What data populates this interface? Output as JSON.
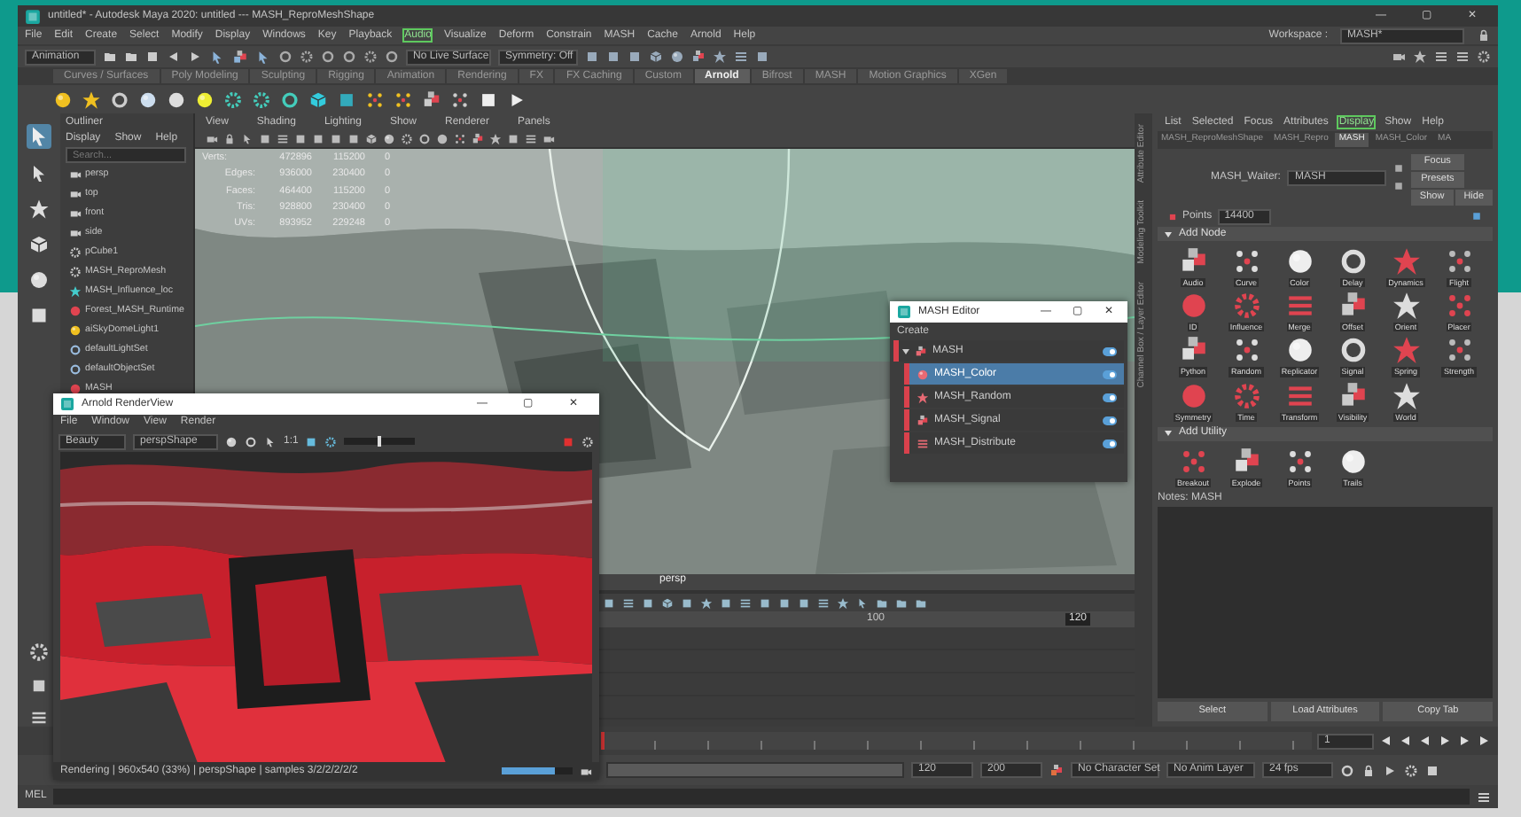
{
  "window": {
    "title": "untitled* - Autodesk Maya 2020: untitled   ---   MASH_ReproMeshShape",
    "controls": [
      "—",
      "▢",
      "✕"
    ],
    "workspace_label": "Workspace :",
    "workspace": "MASH*"
  },
  "menu": [
    {
      "label": "File",
      "selected": false
    },
    {
      "label": "Edit",
      "selected": false
    },
    {
      "label": "Create",
      "selected": false
    },
    {
      "label": "Select",
      "selected": false
    },
    {
      "label": "Modify",
      "selected": false
    },
    {
      "label": "Display",
      "selected": false
    },
    {
      "label": "Windows",
      "selected": false
    },
    {
      "label": "Key",
      "selected": false
    },
    {
      "label": "Playback",
      "selected": false
    },
    {
      "label": "Audio",
      "selected": true
    },
    {
      "label": "Visualize",
      "selected": false
    },
    {
      "label": "Deform",
      "selected": false
    },
    {
      "label": "Constrain",
      "selected": false
    },
    {
      "label": "MASH",
      "selected": false
    },
    {
      "label": "Cache",
      "selected": false
    },
    {
      "label": "Arnold",
      "selected": false
    },
    {
      "label": "Help",
      "selected": false
    }
  ],
  "status_line": {
    "mode": "Animation",
    "live_surface": "No Live Surface",
    "symmetry": "Symmetry: Off"
  },
  "shelf_tabs": [
    {
      "label": "Curves / Surfaces",
      "selected": false
    },
    {
      "label": "Poly Modeling",
      "selected": false
    },
    {
      "label": "Sculpting",
      "selected": false
    },
    {
      "label": "Rigging",
      "selected": false
    },
    {
      "label": "Animation",
      "selected": false
    },
    {
      "label": "Rendering",
      "selected": false
    },
    {
      "label": "FX",
      "selected": false
    },
    {
      "label": "FX Caching",
      "selected": false
    },
    {
      "label": "Custom",
      "selected": false
    },
    {
      "label": "Arnold",
      "selected": true
    },
    {
      "label": "Bifrost",
      "selected": false
    },
    {
      "label": "MASH",
      "selected": false
    },
    {
      "label": "Motion Graphics",
      "selected": false
    },
    {
      "label": "XGen",
      "selected": false
    }
  ],
  "outliner": {
    "title": "Outliner",
    "menu": [
      "Display",
      "Show",
      "Help"
    ],
    "placeholder": "Search...",
    "items": [
      {
        "label": "persp",
        "kind": "camera"
      },
      {
        "label": "top",
        "kind": "camera"
      },
      {
        "label": "front",
        "kind": "camera"
      },
      {
        "label": "side",
        "kind": "camera"
      },
      {
        "label": "pCube1",
        "kind": "mesh"
      },
      {
        "label": "MASH_ReproMesh",
        "kind": "mesh"
      },
      {
        "label": "MASH_Influence_loc",
        "kind": "locator"
      },
      {
        "label": "Forest_MASH_Runtime",
        "kind": "runtime"
      },
      {
        "label": "aiSkyDomeLight1",
        "kind": "light"
      },
      {
        "label": "defaultLightSet",
        "kind": "set"
      },
      {
        "label": "defaultObjectSet",
        "kind": "set"
      },
      {
        "label": "MASH",
        "kind": "mash"
      }
    ]
  },
  "viewport": {
    "menu": [
      "View",
      "Shading",
      "Lighting",
      "Show",
      "Renderer",
      "Panels"
    ],
    "hud": [
      {
        "label": "Verts:",
        "values": [
          "472896",
          "115200",
          "0"
        ]
      },
      {
        "label": "Edges:",
        "values": [
          "936000",
          "230400",
          "0"
        ]
      },
      {
        "label": "Faces:",
        "values": [
          "464400",
          "115200",
          "0"
        ]
      },
      {
        "label": "Tris:",
        "values": [
          "928800",
          "230400",
          "0"
        ]
      },
      {
        "label": "UVs:",
        "values": [
          "893952",
          "229248",
          "0"
        ]
      }
    ],
    "camera": "persp"
  },
  "time_editor": {
    "ruler": [
      {
        "label": "100",
        "kind": "tick"
      },
      {
        "label": "120",
        "kind": "end"
      }
    ]
  },
  "attribute_editor": {
    "side_tabs": [
      "Attribute Editor",
      "Modeling Toolkit",
      "Channel Box / Layer Editor"
    ],
    "menu": [
      {
        "label": "List",
        "selected": false
      },
      {
        "label": "Selected",
        "selected": false
      },
      {
        "label": "Focus",
        "selected": false
      },
      {
        "label": "Attributes",
        "selected": false
      },
      {
        "label": "Display",
        "selected": true
      },
      {
        "label": "Show",
        "selected": false
      },
      {
        "label": "Help",
        "selected": false
      }
    ],
    "tabs": [
      {
        "label": "MASH_ReproMeshShape",
        "selected": false
      },
      {
        "label": "MASH_Repro",
        "selected": false
      },
      {
        "label": "MASH",
        "selected": true
      },
      {
        "label": "MASH_Color",
        "selected": false
      },
      {
        "label": "MA",
        "selected": false
      }
    ],
    "waiter_label": "MASH_Waiter:",
    "waiter": "MASH",
    "buttons": [
      "Focus",
      "Presets",
      "Show",
      "Hide"
    ],
    "points_label": "Points",
    "points": "14400",
    "sections": [
      {
        "title": "Add Node",
        "expanded": true,
        "nodes": [
          "Audio",
          "Curve",
          "Color",
          "Delay",
          "Dynamics",
          "Flight",
          "ID",
          "Influence",
          "Merge",
          "Offset",
          "Orient",
          "Placer",
          "Python",
          "Random",
          "Replicator",
          "Signal",
          "Spring",
          "Strength",
          "Symmetry",
          "Time",
          "Transform",
          "Visibility",
          "World"
        ]
      },
      {
        "title": "Add Utility",
        "expanded": true,
        "nodes": [
          "Breakout",
          "Explode",
          "Points",
          "Trails"
        ]
      }
    ],
    "notes_label": "Notes:  MASH",
    "footer": [
      "Select",
      "Load Attributes",
      "Copy Tab"
    ]
  },
  "time_slider": {
    "current_frame": "1",
    "level": 0.0
  },
  "range": {
    "level": 1.0,
    "start": "120",
    "end": "200",
    "character_set": "No Character Set",
    "anim_layer": "No Anim Layer",
    "fps": "24 fps"
  },
  "command_line": {
    "language": "MEL"
  },
  "mash_editor": {
    "title": "MASH Editor",
    "controls": [
      "—",
      "▢",
      "✕"
    ],
    "menu": "Create",
    "rows": [
      {
        "label": "MASH",
        "kind": "network",
        "selected": false,
        "on": true
      },
      {
        "label": "MASH_Color",
        "kind": "node",
        "selected": true,
        "on": true
      },
      {
        "label": "MASH_Random",
        "kind": "node",
        "selected": false,
        "on": true
      },
      {
        "label": "MASH_Signal",
        "kind": "node",
        "selected": false,
        "on": true
      },
      {
        "label": "MASH_Distribute",
        "kind": "node",
        "selected": false,
        "on": true
      }
    ]
  },
  "render_view": {
    "title": "Arnold RenderView",
    "controls": [
      "—",
      "▢",
      "✕"
    ],
    "menu": [
      "File",
      "Window",
      "View",
      "Render"
    ],
    "aov": "Beauty",
    "camera": "perspShape",
    "zoom": "1:1",
    "exposure": {
      "level": 0.5
    },
    "status": "Rendering | 960x540 (33%) | perspShape | samples 3/2/2/2/2/2",
    "progress": {
      "level": 0.75
    }
  }
}
